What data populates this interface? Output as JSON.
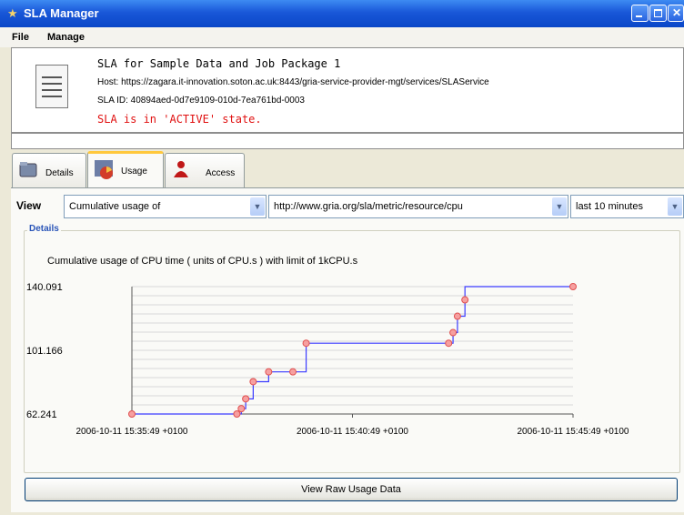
{
  "window": {
    "title": "SLA Manager",
    "buttons": [
      "minimize",
      "maximize",
      "close"
    ]
  },
  "menu": {
    "items": [
      "File",
      "Manage"
    ]
  },
  "sla": {
    "title": "SLA for Sample Data and Job Package 1",
    "host": "Host: https://zagara.it-innovation.soton.ac.uk:8443/gria-service-provider-mgt/services/SLAService",
    "id": "SLA ID: 40894aed-0d7e9109-010d-7ea761bd-0003",
    "state": "SLA is in 'ACTIVE' state.",
    "state_color": "#e01010"
  },
  "tabs": [
    {
      "label": "Details",
      "icon": "folder-icon",
      "active": false
    },
    {
      "label": "Usage",
      "icon": "pie-chart-icon",
      "active": true
    },
    {
      "label": "Access",
      "icon": "user-icon",
      "active": false
    }
  ],
  "view": {
    "label": "View",
    "usage_type": "Cumulative usage of",
    "metric": "http://www.gria.org/sla/metric/resource/cpu",
    "period": "last 10 minutes"
  },
  "details_legend": "Details",
  "chart_data": {
    "type": "line",
    "title": "Cumulative usage of CPU time ( units of CPU.s ) with limit of 1kCPU.s",
    "y_ticks": [
      "140.091",
      "101.166",
      "62.241"
    ],
    "x_ticks": [
      "2006-10-11 15:35:49 +0100",
      "2006-10-11 15:40:49 +0100",
      "2006-10-11 15:45:49 +0100"
    ],
    "xlim_minutes": [
      0,
      10
    ],
    "ylim": [
      62.241,
      140.091
    ],
    "line_color": "#3b3bff",
    "marker_color": "#e05050",
    "step": true,
    "points": [
      {
        "x": 0.0,
        "y": 62.241
      },
      {
        "x": 2.38,
        "y": 62.241
      },
      {
        "x": 2.48,
        "y": 65.5
      },
      {
        "x": 2.58,
        "y": 71.5
      },
      {
        "x": 2.75,
        "y": 82.0
      },
      {
        "x": 3.1,
        "y": 88.0
      },
      {
        "x": 3.65,
        "y": 88.0
      },
      {
        "x": 3.95,
        "y": 105.5
      },
      {
        "x": 7.18,
        "y": 105.5
      },
      {
        "x": 7.28,
        "y": 112.0
      },
      {
        "x": 7.38,
        "y": 122.0
      },
      {
        "x": 7.55,
        "y": 132.0
      },
      {
        "x": 10.0,
        "y": 140.091
      }
    ]
  },
  "raw_button": "View Raw Usage Data"
}
